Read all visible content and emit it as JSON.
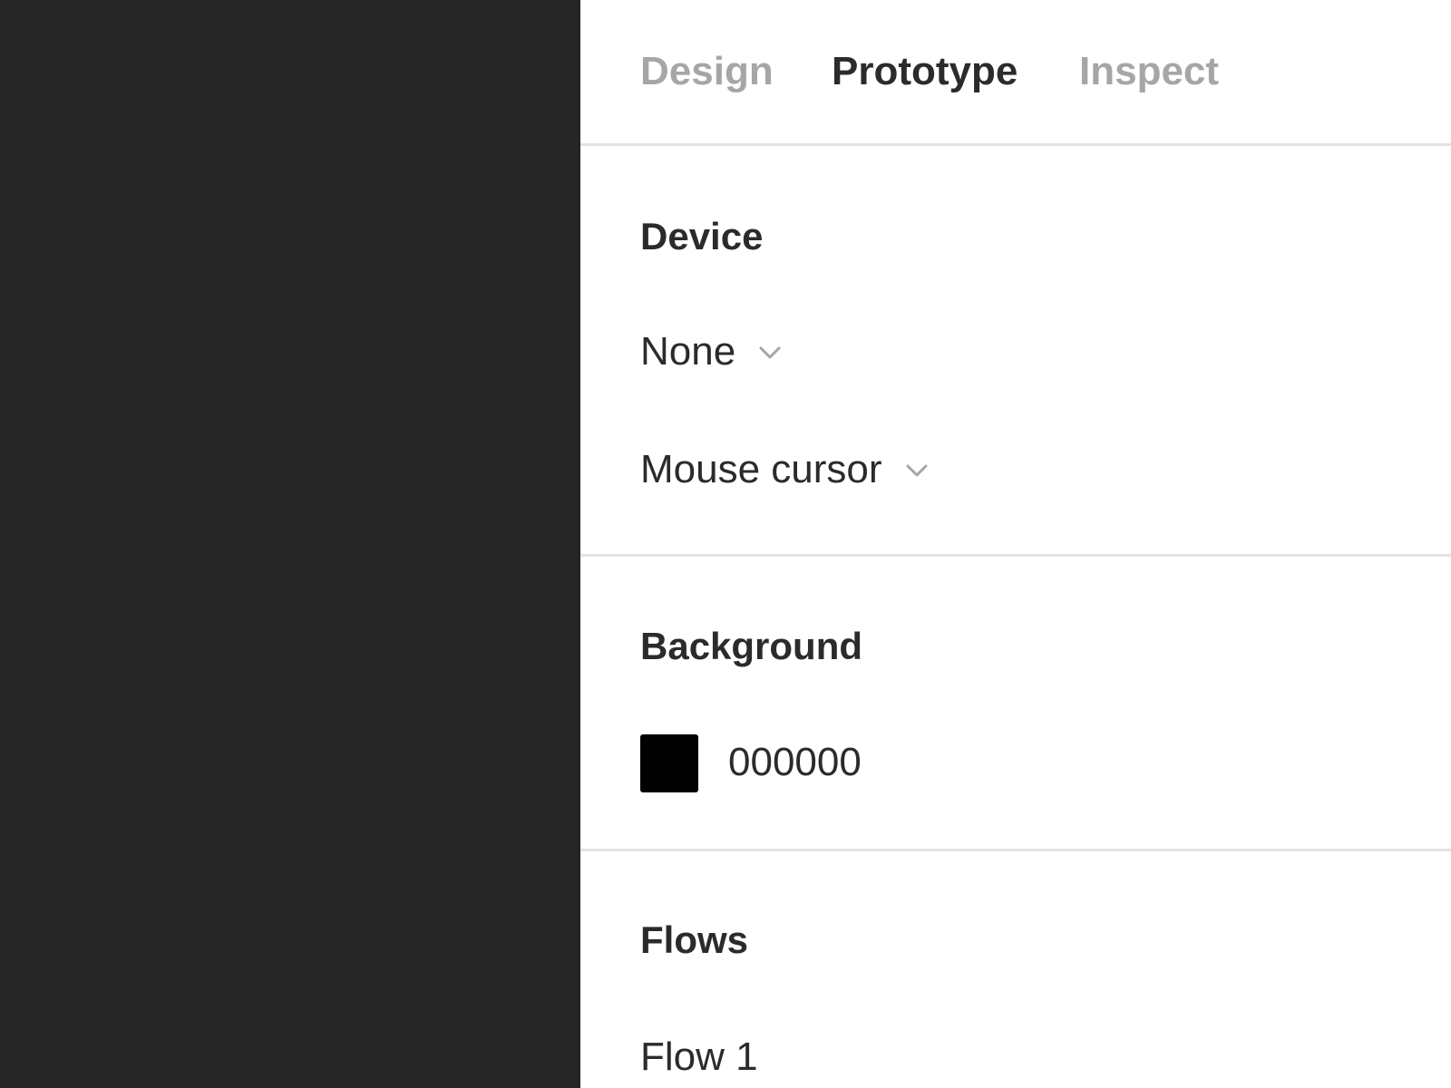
{
  "tabs": [
    {
      "label": "Design",
      "active": false
    },
    {
      "label": "Prototype",
      "active": true
    },
    {
      "label": "Inspect",
      "active": false
    }
  ],
  "device": {
    "title": "Device",
    "device_value": "None",
    "cursor_value": "Mouse cursor"
  },
  "background": {
    "title": "Background",
    "hex": "000000",
    "swatch_color": "#000000"
  },
  "flows": {
    "title": "Flows",
    "items": [
      "Flow 1"
    ]
  },
  "icons": {
    "dropdown": "chevron-down-icon"
  },
  "colors": {
    "canvas": "#262626",
    "panel": "#ffffff",
    "text": "#2b2b2b",
    "muted": "#a6a6a6",
    "divider": "#e3e3e3"
  }
}
